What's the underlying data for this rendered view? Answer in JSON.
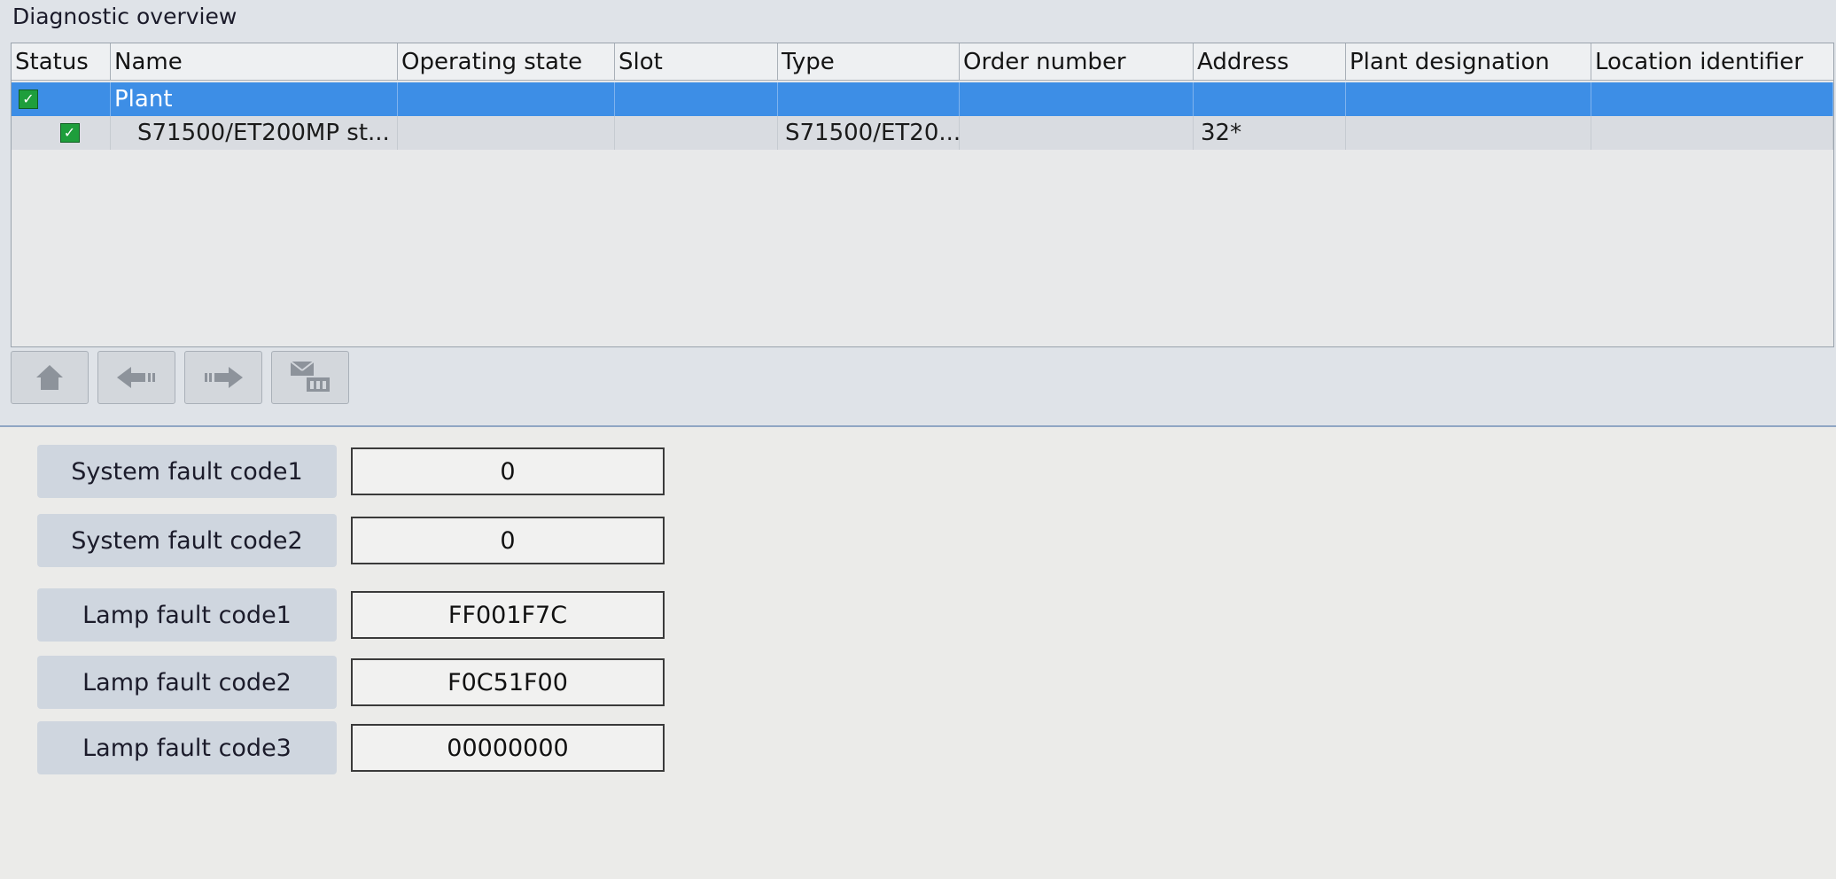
{
  "panel": {
    "title": "Diagnostic overview"
  },
  "table": {
    "columns": [
      "Status",
      "Name",
      "Operating state",
      "Slot",
      "Type",
      "Order number",
      "Address",
      "Plant designation",
      "Location identifier"
    ],
    "rows": [
      {
        "status": "ok",
        "name": "Plant",
        "operating_state": "",
        "slot": "",
        "type": "",
        "order_number": "",
        "address": "",
        "plant_designation": "",
        "location_identifier": ""
      },
      {
        "status": "ok",
        "name": "S71500/ET200MP st...",
        "operating_state": "",
        "slot": "",
        "type": "S71500/ET20...",
        "order_number": "",
        "address": "32*",
        "plant_designation": "",
        "location_identifier": ""
      }
    ]
  },
  "toolbar": {
    "buttons": [
      {
        "icon": "home-icon"
      },
      {
        "icon": "arrow-left-icon"
      },
      {
        "icon": "arrow-right-icon"
      },
      {
        "icon": "diagnostic-buffer-icon"
      }
    ]
  },
  "fault_codes": [
    {
      "label": "System fault code1",
      "value": "0"
    },
    {
      "label": "System fault code2",
      "value": "0"
    },
    {
      "label": "Lamp fault code1",
      "value": "FF001F7C"
    },
    {
      "label": "Lamp fault code2",
      "value": "F0C51F00"
    },
    {
      "label": "Lamp fault code3",
      "value": "00000000"
    }
  ],
  "colors": {
    "selection": "#3d8ee6",
    "status_ok": "#1e9e3c"
  }
}
